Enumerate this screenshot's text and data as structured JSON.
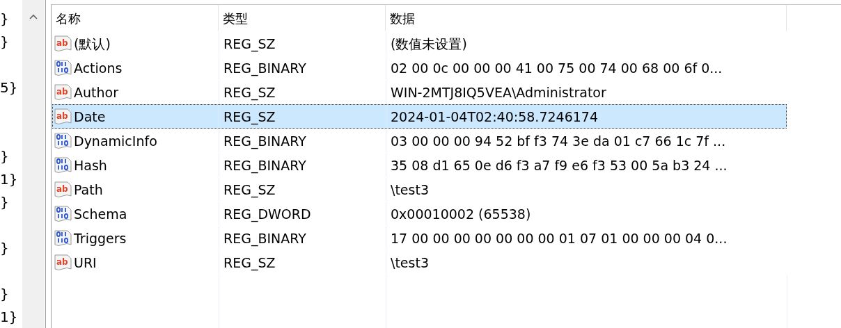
{
  "tree_fragments": [
    "}",
    "}",
    "5}",
    "}",
    "1}",
    "}",
    "}",
    "}",
    "1}"
  ],
  "table": {
    "columns": [
      "名称",
      "类型",
      "数据"
    ],
    "rows": [
      {
        "kind": "string",
        "icon_label": "ab",
        "name": "(默认)",
        "type": "REG_SZ",
        "data": "(数值未设置)",
        "selected": false
      },
      {
        "kind": "binary",
        "name": "Actions",
        "type": "REG_BINARY",
        "data": "02 00 0c 00 00 00 41 00 75 00 74 00 68 00 6f 0...",
        "selected": false
      },
      {
        "kind": "string",
        "icon_label": "ab",
        "name": "Author",
        "type": "REG_SZ",
        "data": "WIN-2MTJ8IQ5VEA\\Administrator",
        "selected": false
      },
      {
        "kind": "string",
        "icon_label": "ab",
        "name": "Date",
        "type": "REG_SZ",
        "data": "2024-01-04T02:40:58.7246174",
        "selected": true
      },
      {
        "kind": "binary",
        "name": "DynamicInfo",
        "type": "REG_BINARY",
        "data": "03 00 00 00 94 52 bf f3 74 3e da 01 c7 66 1c 7f ...",
        "selected": false
      },
      {
        "kind": "binary",
        "name": "Hash",
        "type": "REG_BINARY",
        "data": "35 08 d1 65 0e d6 f3 a7 f9 e6 f3 53 00 5a b3 24 ...",
        "selected": false
      },
      {
        "kind": "string",
        "icon_label": "ab",
        "name": "Path",
        "type": "REG_SZ",
        "data": "\\test3",
        "selected": false
      },
      {
        "kind": "binary",
        "name": "Schema",
        "type": "REG_DWORD",
        "data": "0x00010002 (65538)",
        "selected": false
      },
      {
        "kind": "binary",
        "name": "Triggers",
        "type": "REG_BINARY",
        "data": "17 00 00 00 00 00 00 00 01 07 01 00 00 00 04 0...",
        "selected": false
      },
      {
        "kind": "string",
        "icon_label": "ab",
        "name": "URI",
        "type": "REG_SZ",
        "data": "\\test3",
        "selected": false
      }
    ]
  }
}
